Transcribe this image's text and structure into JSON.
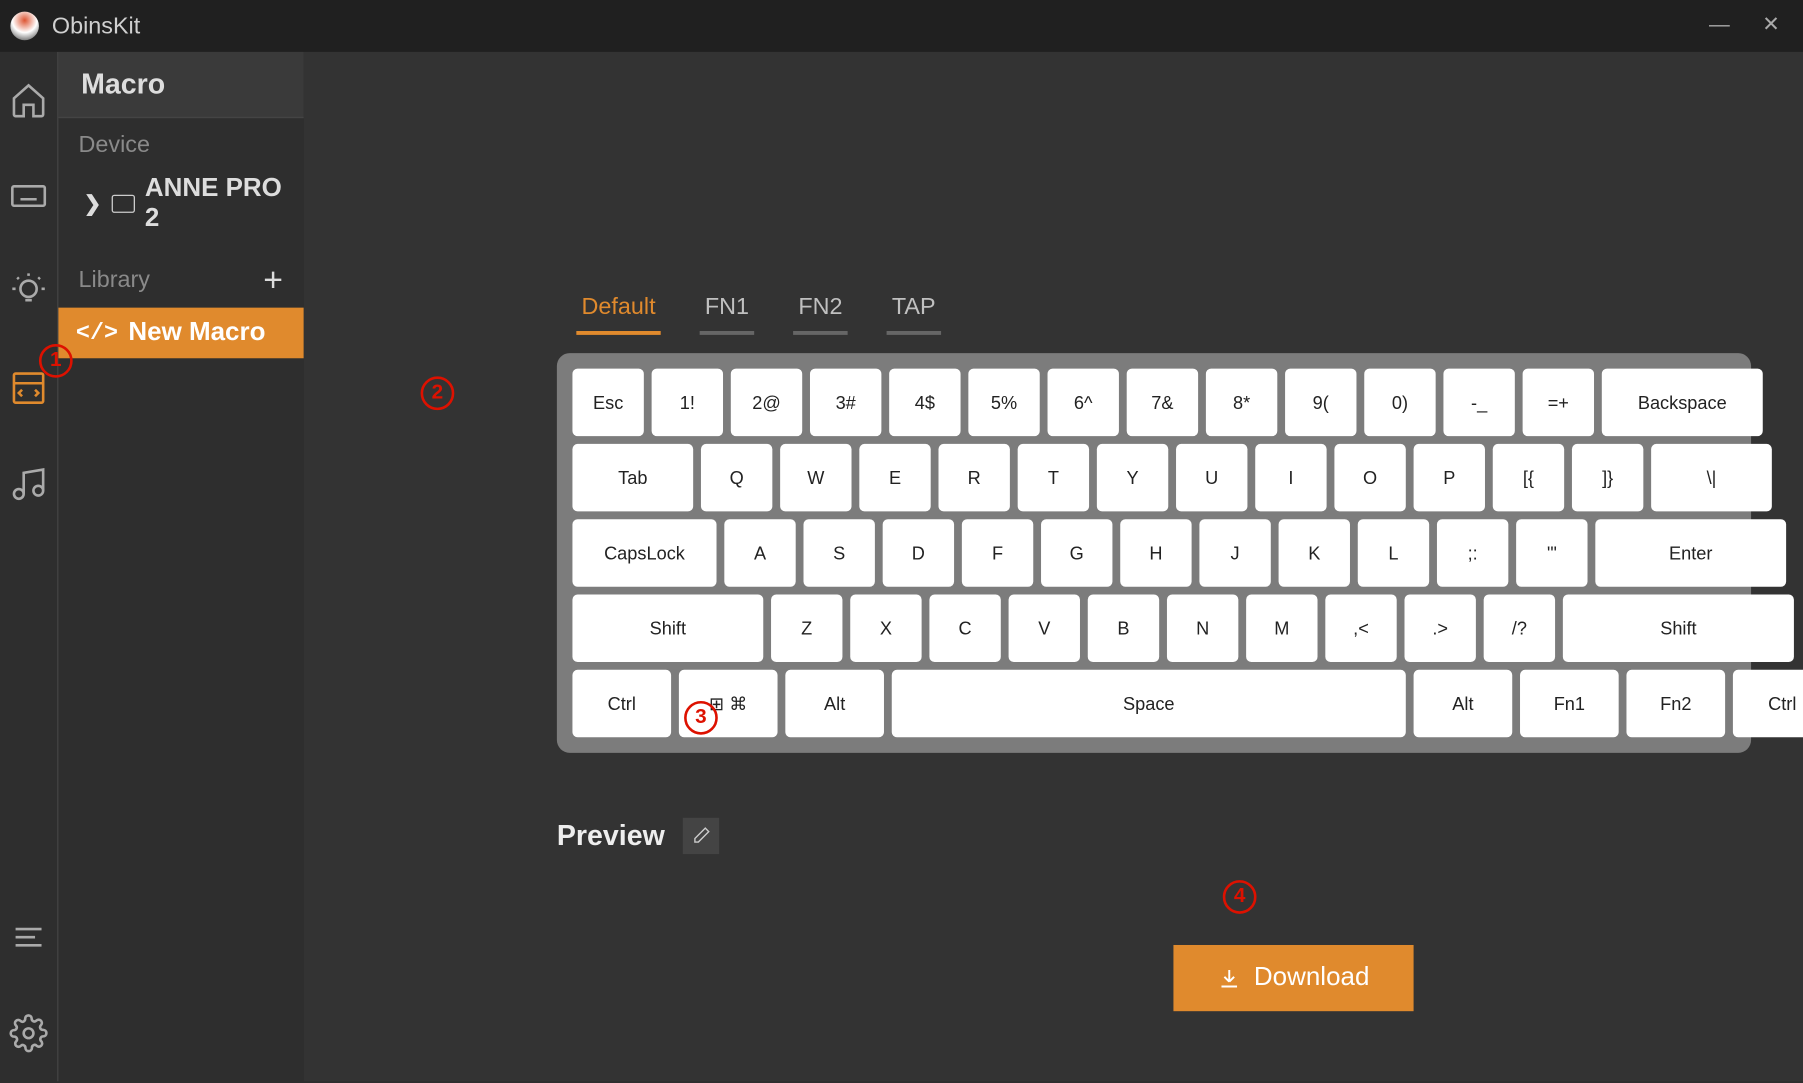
{
  "app": {
    "title": "ObinsKit"
  },
  "window_controls": {
    "minimize": "—",
    "close": "✕"
  },
  "sidebar": {
    "header": "Macro",
    "device_label": "Device",
    "device_name": "ANNE PRO 2",
    "library_label": "Library",
    "macro_item": "New Macro"
  },
  "tabs": [
    "Default",
    "FN1",
    "FN2",
    "TAP"
  ],
  "active_tab": 0,
  "keyboard": {
    "row0": [
      "Esc",
      "1!",
      "2@",
      "3#",
      "4$",
      "5%",
      "6^",
      "7&",
      "8*",
      "9(",
      "0)",
      "-_",
      "=+",
      "Backspace"
    ],
    "row1": [
      "Tab",
      "Q",
      "W",
      "E",
      "R",
      "T",
      "Y",
      "U",
      "I",
      "O",
      "P",
      "[{",
      "]}",
      "\\|"
    ],
    "row2": [
      "CapsLock",
      "A",
      "S",
      "D",
      "F",
      "G",
      "H",
      "J",
      "K",
      "L",
      ";:",
      "'\"",
      "Enter"
    ],
    "row3": [
      "Shift",
      "Z",
      "X",
      "C",
      "V",
      "B",
      "N",
      "M",
      ",<",
      ".>",
      "/?",
      "Shift"
    ],
    "row4": [
      "Ctrl",
      "Win",
      "Alt",
      "Space",
      "Alt",
      "Fn1",
      "Fn2",
      "Ctrl"
    ]
  },
  "preview_label": "Preview",
  "download_label": "Download",
  "annotations": {
    "a1": "1",
    "a2": "2",
    "a3": "3",
    "a4": "4"
  },
  "colors": {
    "accent": "#e08a2d"
  }
}
